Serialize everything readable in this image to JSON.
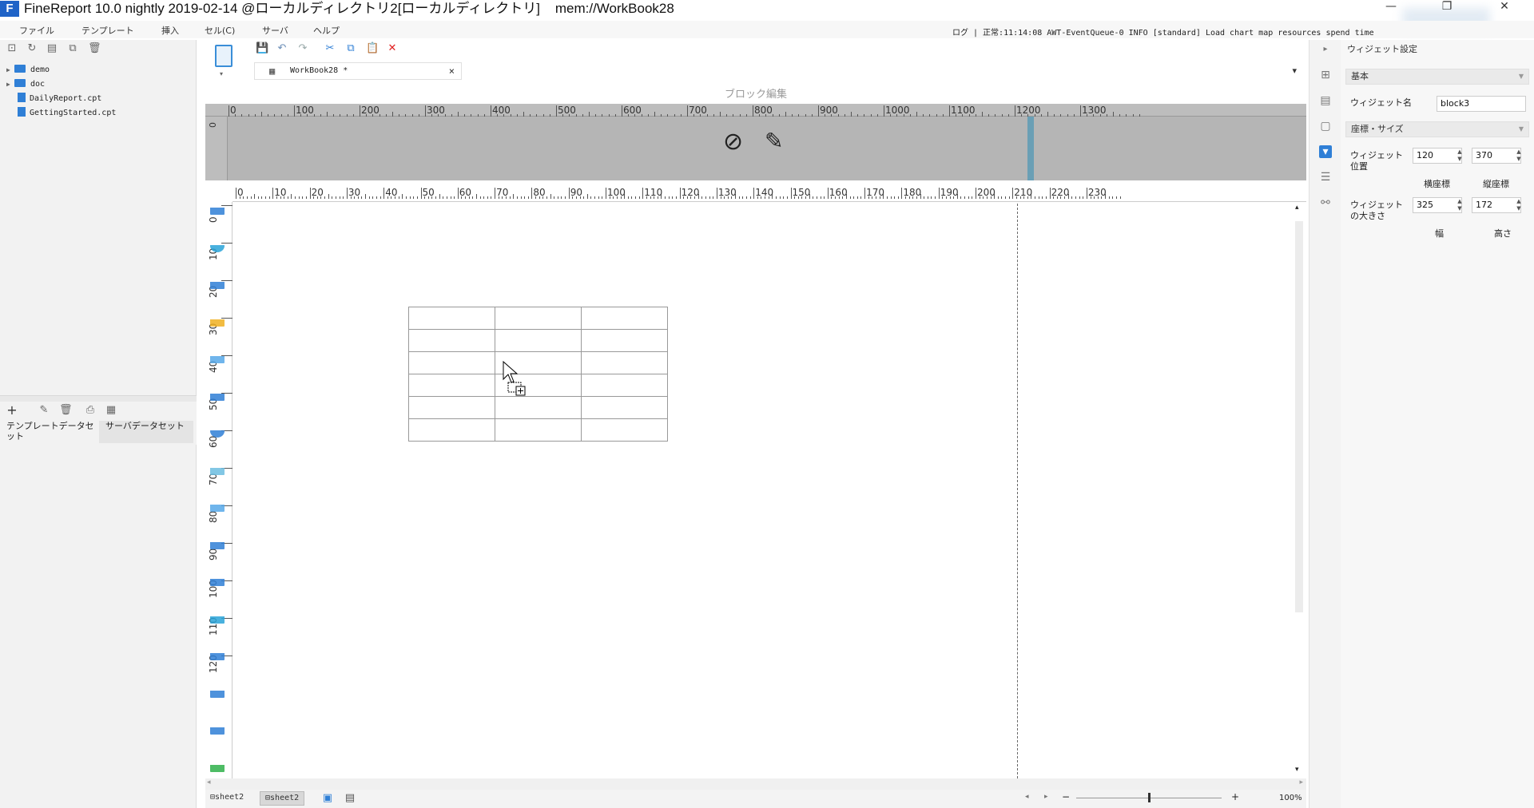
{
  "window": {
    "title": "FineReport 10.0 nightly 2019-02-14 @ローカルディレクトリ2[ローカルディレクトリ]    mem://WorkBook28",
    "logo": "F",
    "controls": [
      "—",
      "❐",
      "✕"
    ]
  },
  "menu": [
    "ファイル",
    "テンプレート",
    "挿入",
    "セル(C)",
    "サーバ",
    "ヘルプ"
  ],
  "log": {
    "text": "ログ | 正常:11:14:08 AWT-EventQueue-0 INFO [standard] Load chart map resources spend time"
  },
  "file_tree": {
    "items": [
      {
        "type": "folder",
        "label": "demo"
      },
      {
        "type": "folder",
        "label": "doc"
      },
      {
        "type": "file",
        "label": "DailyReport.cpt"
      },
      {
        "type": "file",
        "label": "GettingStarted.cpt"
      }
    ]
  },
  "dataset_tabs": [
    "テンプレートデータセット",
    "サーバデータセット"
  ],
  "editor_tab": {
    "label": "WorkBook28 *",
    "close": "×"
  },
  "block_edit": {
    "header": "ブロック編集"
  },
  "ruler_top": [
    "0",
    "100",
    "200",
    "300",
    "400",
    "500",
    "600",
    "700",
    "800",
    "900",
    "1000",
    "1100",
    "1200",
    "1300"
  ],
  "ruler_block_left": [
    "0"
  ],
  "ruler_canvas_top": [
    "0",
    "10",
    "20",
    "30",
    "40",
    "50",
    "60",
    "70",
    "80",
    "90",
    "100",
    "110",
    "120",
    "130",
    "140",
    "150",
    "160",
    "170",
    "180",
    "190",
    "200",
    "210",
    "220",
    "230"
  ],
  "ruler_canvas_left": [
    "0",
    "10",
    "20",
    "30",
    "40",
    "50",
    "60",
    "70",
    "80",
    "90",
    "100",
    "110",
    "120"
  ],
  "sheets": [
    "sheet2",
    "sheet2"
  ],
  "zoom": {
    "label": "100%",
    "minus": "−",
    "plus": "+"
  },
  "right_panel": {
    "title": "ウィジェット設定",
    "section_basic": "基本",
    "widget_name_label": "ウィジェット名",
    "widget_name_value": "block3",
    "section_coords": "座標・サイズ",
    "position_label": "ウィジェット位置",
    "pos_x": "120",
    "pos_y": "370",
    "pos_x_label": "横座標",
    "pos_y_label": "縦座標",
    "size_label": "ウィジェットの大きさ",
    "width": "325",
    "height": "172",
    "width_label": "幅",
    "height_label": "高さ"
  },
  "colors": {
    "accent": "#1f63c7",
    "block_area": "#b5b5b5",
    "block_marker": "#6a9fb5"
  }
}
